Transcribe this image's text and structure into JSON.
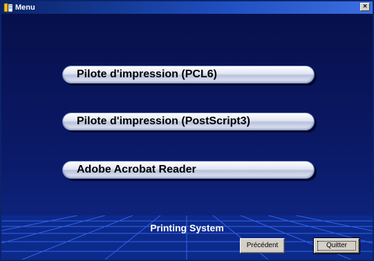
{
  "window": {
    "title": "Menu",
    "close_label": "×"
  },
  "menu": {
    "items": [
      {
        "label": "Pilote d'impression (PCL6)"
      },
      {
        "label": "Pilote d'impression (PostScript3)"
      },
      {
        "label": "Adobe Acrobat Reader"
      }
    ]
  },
  "footer": {
    "label": "Printing System",
    "back_label": "Précédent",
    "quit_label": "Quitter"
  },
  "colors": {
    "titlebar": "#0a246a",
    "background": "#0a1456",
    "grid_lines": "#3a6cff"
  }
}
